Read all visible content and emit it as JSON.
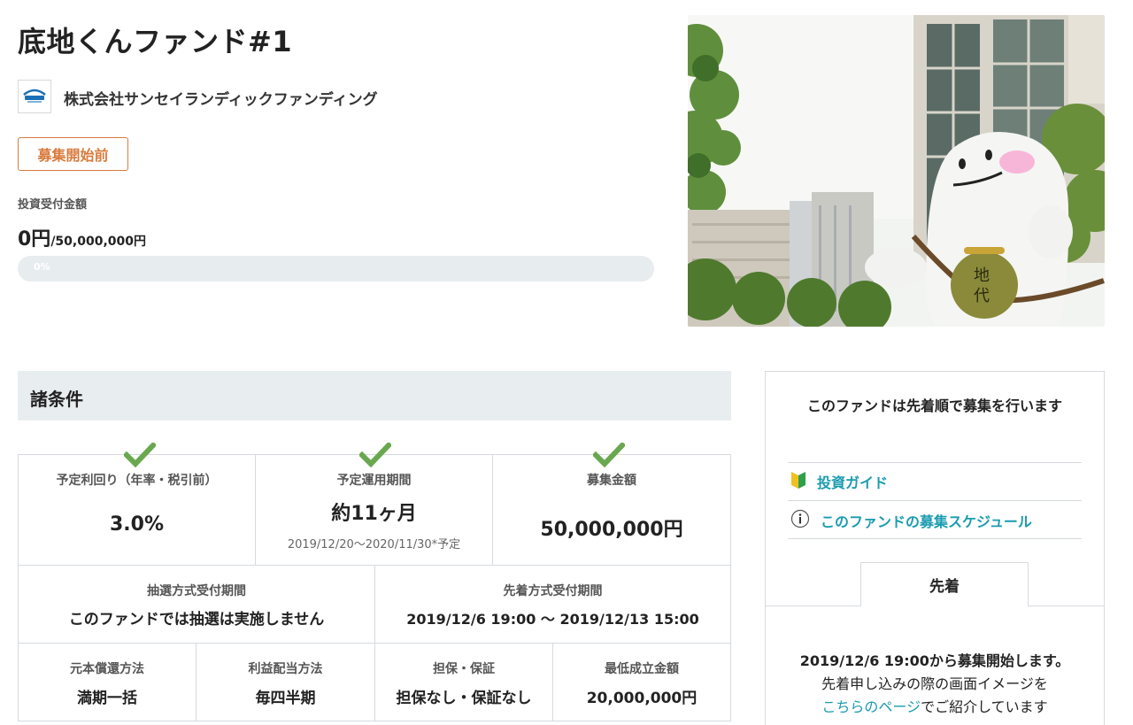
{
  "fund": {
    "title": "底地くんファンド#1",
    "company": "株式会社サンセイランディックファンディング",
    "status": "募集開始前",
    "amount_label": "投資受付金額",
    "amount_current": "0円",
    "amount_target": "/50,000,000円",
    "progress_percent": 0,
    "progress_text": "0%"
  },
  "conditions": {
    "section_title": "諸条件",
    "yield_label": "予定利回り（年率・税引前）",
    "yield_value": "3.0%",
    "period_label": "予定運用期間",
    "period_value": "約11ヶ月",
    "period_range": "2019/12/20〜2020/11/30*予定",
    "raise_label": "募集金額",
    "raise_value": "50,000,000円",
    "lottery_label": "抽選方式受付期間",
    "lottery_value": "このファンドでは抽選は実施しません",
    "firstcome_label": "先着方式受付期間",
    "firstcome_value": "2019/12/6 19:00 〜 2019/12/13 15:00",
    "repay_label": "元本償還方法",
    "repay_value": "満期一括",
    "dividend_label": "利益配当方法",
    "dividend_value": "毎四半期",
    "collateral_label": "担保・保証",
    "collateral_value": "担保なし・保証なし",
    "min_label": "最低成立金額",
    "min_value": "20,000,000円"
  },
  "side": {
    "heading": "このファンドは先着順で募集を行います",
    "guide_link": "投資ガイド",
    "schedule_link": "このファンドの募集スケジュール",
    "tab": "先着",
    "start_text": "2019/12/6 19:00から募集開始します。",
    "desc_text": "先着申し込みの際の画面イメージを",
    "page_link": "こちらのページ",
    "desc_suffix": "でご紹介しています"
  },
  "icons": {
    "check": "check-icon",
    "guide": "beginner-mark-icon",
    "info": "info-icon"
  },
  "colors": {
    "accent_orange": "#d97b3c",
    "link_teal": "#1a9cb0",
    "check_green": "#6aa84f"
  }
}
